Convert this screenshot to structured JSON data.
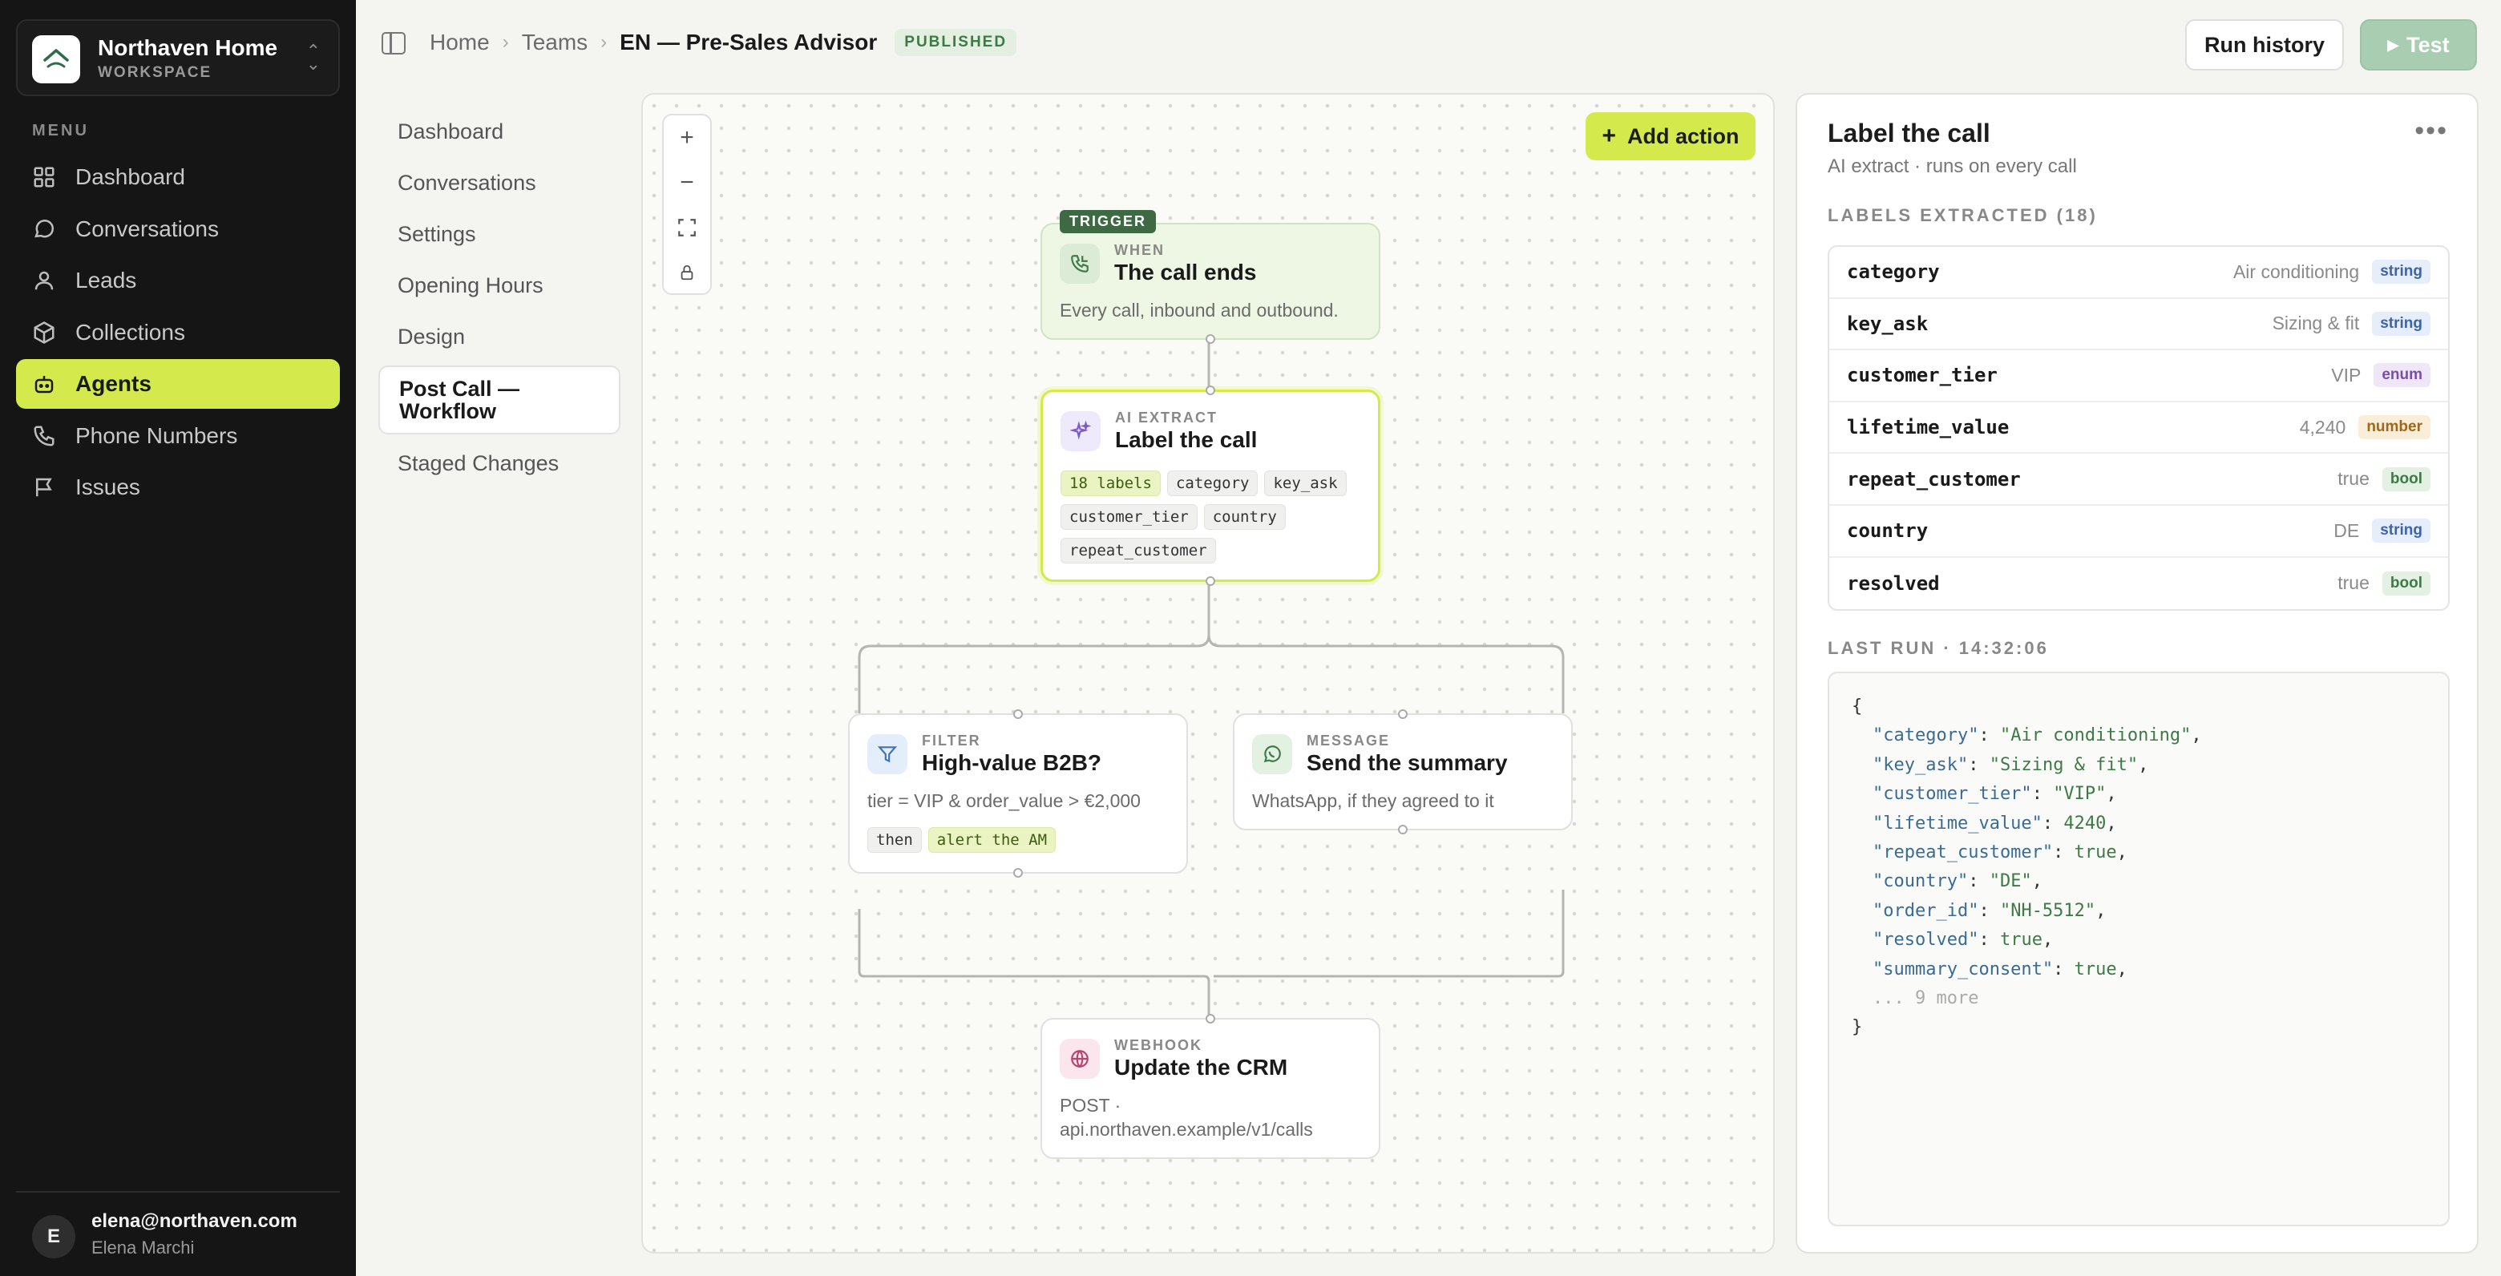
{
  "workspace": {
    "name": "Northaven Home",
    "label": "WORKSPACE"
  },
  "menu_label": "MENU",
  "nav": [
    {
      "label": "Dashboard",
      "icon": "grid-icon"
    },
    {
      "label": "Conversations",
      "icon": "chat-icon"
    },
    {
      "label": "Leads",
      "icon": "person-icon"
    },
    {
      "label": "Collections",
      "icon": "cube-icon"
    },
    {
      "label": "Agents",
      "icon": "bot-icon",
      "active": true
    },
    {
      "label": "Phone Numbers",
      "icon": "phone-icon"
    },
    {
      "label": "Issues",
      "icon": "flag-icon"
    }
  ],
  "user": {
    "initial": "E",
    "email": "elena@northaven.com",
    "name": "Elena Marchi"
  },
  "breadcrumb": {
    "home": "Home",
    "teams": "Teams",
    "current": "EN — Pre-Sales Advisor",
    "status": "PUBLISHED"
  },
  "toolbar": {
    "history": "Run history",
    "test": "Test"
  },
  "subnav": [
    "Dashboard",
    "Conversations",
    "Settings",
    "Opening Hours",
    "Design",
    "Post Call — Workflow",
    "Staged Changes"
  ],
  "canvas": {
    "add_action": "Add action",
    "trigger": {
      "tag": "TRIGGER",
      "kind": "WHEN",
      "title": "The call ends",
      "desc": "Every call, inbound and outbound."
    },
    "extract": {
      "kind": "AI EXTRACT",
      "title": "Label the call",
      "chips": [
        "18 labels",
        "category",
        "key_ask",
        "customer_tier",
        "country",
        "repeat_customer"
      ]
    },
    "filter": {
      "kind": "FILTER",
      "title": "High-value B2B?",
      "desc": "tier = VIP & order_value > €2,000",
      "chips": [
        "then",
        "alert the AM"
      ]
    },
    "message": {
      "kind": "MESSAGE",
      "title": "Send the summary",
      "desc": "WhatsApp, if they agreed to it"
    },
    "webhook": {
      "kind": "WEBHOOK",
      "title": "Update the CRM",
      "desc1": "POST ·",
      "desc2": "api.northaven.example/v1/calls"
    }
  },
  "panel": {
    "title": "Label the call",
    "subtitle": "AI extract · runs on every call",
    "labels_heading": "LABELS EXTRACTED (18)",
    "labels": [
      {
        "key": "category",
        "value": "Air conditioning",
        "type": "string"
      },
      {
        "key": "key_ask",
        "value": "Sizing & fit",
        "type": "string"
      },
      {
        "key": "customer_tier",
        "value": "VIP",
        "type": "enum"
      },
      {
        "key": "lifetime_value",
        "value": "4,240",
        "type": "number"
      },
      {
        "key": "repeat_customer",
        "value": "true",
        "type": "bool"
      },
      {
        "key": "country",
        "value": "DE",
        "type": "string"
      },
      {
        "key": "resolved",
        "value": "true",
        "type": "bool"
      }
    ],
    "last_run_heading": "LAST RUN · 14:32:06",
    "json": {
      "open": "{",
      "lines": [
        {
          "k": "\"category\"",
          "v": "\"Air conditioning\"",
          "t": "s"
        },
        {
          "k": "\"key_ask\"",
          "v": "\"Sizing & fit\"",
          "t": "s"
        },
        {
          "k": "\"customer_tier\"",
          "v": "\"VIP\"",
          "t": "s"
        },
        {
          "k": "\"lifetime_value\"",
          "v": "4240",
          "t": "n"
        },
        {
          "k": "\"repeat_customer\"",
          "v": "true",
          "t": "n"
        },
        {
          "k": "\"country\"",
          "v": "\"DE\"",
          "t": "s"
        },
        {
          "k": "\"order_id\"",
          "v": "\"NH-5512\"",
          "t": "s"
        },
        {
          "k": "\"resolved\"",
          "v": "true",
          "t": "n"
        },
        {
          "k": "\"summary_consent\"",
          "v": "true",
          "t": "n"
        }
      ],
      "more": "... 9 more",
      "close": "}"
    }
  }
}
